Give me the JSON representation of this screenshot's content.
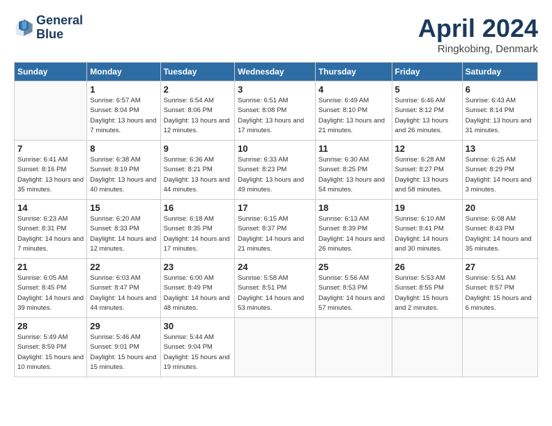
{
  "header": {
    "logo_line1": "General",
    "logo_line2": "Blue",
    "month": "April 2024",
    "location": "Ringkobing, Denmark"
  },
  "columns": [
    "Sunday",
    "Monday",
    "Tuesday",
    "Wednesday",
    "Thursday",
    "Friday",
    "Saturday"
  ],
  "weeks": [
    [
      {
        "day": "",
        "sunrise": "",
        "sunset": "",
        "daylight": ""
      },
      {
        "day": "1",
        "sunrise": "Sunrise: 6:57 AM",
        "sunset": "Sunset: 8:04 PM",
        "daylight": "Daylight: 13 hours and 7 minutes."
      },
      {
        "day": "2",
        "sunrise": "Sunrise: 6:54 AM",
        "sunset": "Sunset: 8:06 PM",
        "daylight": "Daylight: 13 hours and 12 minutes."
      },
      {
        "day": "3",
        "sunrise": "Sunrise: 6:51 AM",
        "sunset": "Sunset: 8:08 PM",
        "daylight": "Daylight: 13 hours and 17 minutes."
      },
      {
        "day": "4",
        "sunrise": "Sunrise: 6:49 AM",
        "sunset": "Sunset: 8:10 PM",
        "daylight": "Daylight: 13 hours and 21 minutes."
      },
      {
        "day": "5",
        "sunrise": "Sunrise: 6:46 AM",
        "sunset": "Sunset: 8:12 PM",
        "daylight": "Daylight: 13 hours and 26 minutes."
      },
      {
        "day": "6",
        "sunrise": "Sunrise: 6:43 AM",
        "sunset": "Sunset: 8:14 PM",
        "daylight": "Daylight: 13 hours and 31 minutes."
      }
    ],
    [
      {
        "day": "7",
        "sunrise": "Sunrise: 6:41 AM",
        "sunset": "Sunset: 8:16 PM",
        "daylight": "Daylight: 13 hours and 35 minutes."
      },
      {
        "day": "8",
        "sunrise": "Sunrise: 6:38 AM",
        "sunset": "Sunset: 8:19 PM",
        "daylight": "Daylight: 13 hours and 40 minutes."
      },
      {
        "day": "9",
        "sunrise": "Sunrise: 6:36 AM",
        "sunset": "Sunset: 8:21 PM",
        "daylight": "Daylight: 13 hours and 44 minutes."
      },
      {
        "day": "10",
        "sunrise": "Sunrise: 6:33 AM",
        "sunset": "Sunset: 8:23 PM",
        "daylight": "Daylight: 13 hours and 49 minutes."
      },
      {
        "day": "11",
        "sunrise": "Sunrise: 6:30 AM",
        "sunset": "Sunset: 8:25 PM",
        "daylight": "Daylight: 13 hours and 54 minutes."
      },
      {
        "day": "12",
        "sunrise": "Sunrise: 6:28 AM",
        "sunset": "Sunset: 8:27 PM",
        "daylight": "Daylight: 13 hours and 58 minutes."
      },
      {
        "day": "13",
        "sunrise": "Sunrise: 6:25 AM",
        "sunset": "Sunset: 8:29 PM",
        "daylight": "Daylight: 14 hours and 3 minutes."
      }
    ],
    [
      {
        "day": "14",
        "sunrise": "Sunrise: 6:23 AM",
        "sunset": "Sunset: 8:31 PM",
        "daylight": "Daylight: 14 hours and 7 minutes."
      },
      {
        "day": "15",
        "sunrise": "Sunrise: 6:20 AM",
        "sunset": "Sunset: 8:33 PM",
        "daylight": "Daylight: 14 hours and 12 minutes."
      },
      {
        "day": "16",
        "sunrise": "Sunrise: 6:18 AM",
        "sunset": "Sunset: 8:35 PM",
        "daylight": "Daylight: 14 hours and 17 minutes."
      },
      {
        "day": "17",
        "sunrise": "Sunrise: 6:15 AM",
        "sunset": "Sunset: 8:37 PM",
        "daylight": "Daylight: 14 hours and 21 minutes."
      },
      {
        "day": "18",
        "sunrise": "Sunrise: 6:13 AM",
        "sunset": "Sunset: 8:39 PM",
        "daylight": "Daylight: 14 hours and 26 minutes."
      },
      {
        "day": "19",
        "sunrise": "Sunrise: 6:10 AM",
        "sunset": "Sunset: 8:41 PM",
        "daylight": "Daylight: 14 hours and 30 minutes."
      },
      {
        "day": "20",
        "sunrise": "Sunrise: 6:08 AM",
        "sunset": "Sunset: 8:43 PM",
        "daylight": "Daylight: 14 hours and 35 minutes."
      }
    ],
    [
      {
        "day": "21",
        "sunrise": "Sunrise: 6:05 AM",
        "sunset": "Sunset: 8:45 PM",
        "daylight": "Daylight: 14 hours and 39 minutes."
      },
      {
        "day": "22",
        "sunrise": "Sunrise: 6:03 AM",
        "sunset": "Sunset: 8:47 PM",
        "daylight": "Daylight: 14 hours and 44 minutes."
      },
      {
        "day": "23",
        "sunrise": "Sunrise: 6:00 AM",
        "sunset": "Sunset: 8:49 PM",
        "daylight": "Daylight: 14 hours and 48 minutes."
      },
      {
        "day": "24",
        "sunrise": "Sunrise: 5:58 AM",
        "sunset": "Sunset: 8:51 PM",
        "daylight": "Daylight: 14 hours and 53 minutes."
      },
      {
        "day": "25",
        "sunrise": "Sunrise: 5:56 AM",
        "sunset": "Sunset: 8:53 PM",
        "daylight": "Daylight: 14 hours and 57 minutes."
      },
      {
        "day": "26",
        "sunrise": "Sunrise: 5:53 AM",
        "sunset": "Sunset: 8:55 PM",
        "daylight": "Daylight: 15 hours and 2 minutes."
      },
      {
        "day": "27",
        "sunrise": "Sunrise: 5:51 AM",
        "sunset": "Sunset: 8:57 PM",
        "daylight": "Daylight: 15 hours and 6 minutes."
      }
    ],
    [
      {
        "day": "28",
        "sunrise": "Sunrise: 5:49 AM",
        "sunset": "Sunset: 8:59 PM",
        "daylight": "Daylight: 15 hours and 10 minutes."
      },
      {
        "day": "29",
        "sunrise": "Sunrise: 5:46 AM",
        "sunset": "Sunset: 9:01 PM",
        "daylight": "Daylight: 15 hours and 15 minutes."
      },
      {
        "day": "30",
        "sunrise": "Sunrise: 5:44 AM",
        "sunset": "Sunset: 9:04 PM",
        "daylight": "Daylight: 15 hours and 19 minutes."
      },
      {
        "day": "",
        "sunrise": "",
        "sunset": "",
        "daylight": ""
      },
      {
        "day": "",
        "sunrise": "",
        "sunset": "",
        "daylight": ""
      },
      {
        "day": "",
        "sunrise": "",
        "sunset": "",
        "daylight": ""
      },
      {
        "day": "",
        "sunrise": "",
        "sunset": "",
        "daylight": ""
      }
    ]
  ]
}
